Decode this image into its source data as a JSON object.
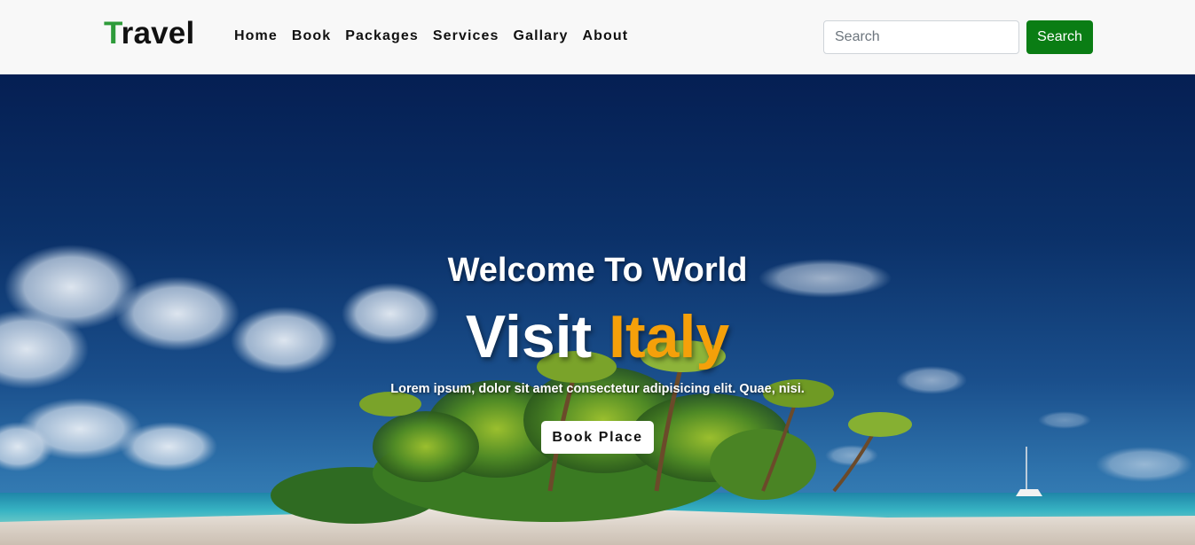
{
  "brand": {
    "first_letter": "T",
    "rest": "ravel"
  },
  "nav": {
    "items": [
      {
        "label": "Home"
      },
      {
        "label": "Book"
      },
      {
        "label": "Packages"
      },
      {
        "label": "Services"
      },
      {
        "label": "Gallary"
      },
      {
        "label": "About"
      }
    ]
  },
  "search": {
    "placeholder": "Search",
    "value": "",
    "button_label": "Search"
  },
  "hero": {
    "welcome": "Welcome To World",
    "title_main": "Visit",
    "title_accent": "Italy",
    "description": "Lorem ipsum, dolor sit amet consectetur adipisicing elit. Quae, nisi.",
    "button_label": "Book Place",
    "background_image": "tropical-island-beach"
  },
  "colors": {
    "brand_accent": "#2e9b3a",
    "search_button": "#0a7d14",
    "title_accent": "#f5a00a",
    "nav_background": "#f8f8f8"
  }
}
